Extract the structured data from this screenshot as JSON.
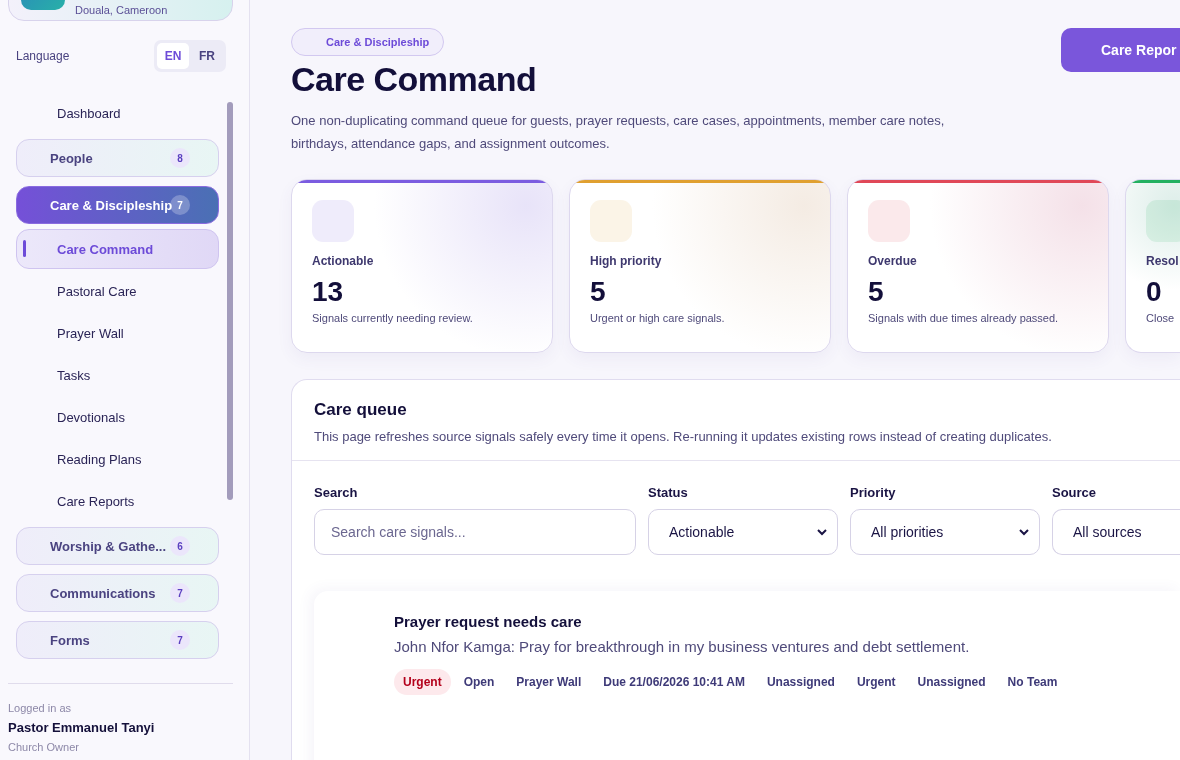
{
  "org": {
    "location": "Douala, Cameroon"
  },
  "language": {
    "label": "Language",
    "options": [
      {
        "label": "EN",
        "selected": true
      },
      {
        "label": "FR",
        "selected": false
      }
    ]
  },
  "nav": [
    {
      "kind": "link",
      "label": "Dashboard",
      "selected": false
    },
    {
      "kind": "group",
      "label": "People",
      "badge": "8",
      "expanded": false
    },
    {
      "kind": "group",
      "label": "Care & Discipleship",
      "badge": "7",
      "expanded": true,
      "children": [
        {
          "label": "Care Command",
          "selected": true
        },
        {
          "label": "Pastoral Care",
          "selected": false
        },
        {
          "label": "Prayer Wall",
          "selected": false
        },
        {
          "label": "Tasks",
          "selected": false
        },
        {
          "label": "Devotionals",
          "selected": false
        },
        {
          "label": "Reading Plans",
          "selected": false
        },
        {
          "label": "Care Reports",
          "selected": false
        }
      ]
    },
    {
      "kind": "group",
      "label": "Worship & Gathe...",
      "badge": "6",
      "expanded": false
    },
    {
      "kind": "group",
      "label": "Communications",
      "badge": "7",
      "expanded": false
    },
    {
      "kind": "group",
      "label": "Forms",
      "badge": "7",
      "expanded": false
    }
  ],
  "user": {
    "caption": "Logged in as",
    "name": "Pastor Emmanuel Tanyi",
    "role": "Church Owner"
  },
  "header": {
    "eyebrow": "Care & Discipleship",
    "title": "Care Command",
    "description": "One non-duplicating command queue for guests, prayer requests, care cases, appointments, member care notes, birthdays, attendance gaps, and assignment outcomes.",
    "action": "Care Repor"
  },
  "stats": [
    {
      "label": "Actionable",
      "value": "13",
      "note": "Signals currently needing review.",
      "color": "#7b5ce0"
    },
    {
      "label": "High priority",
      "value": "5",
      "note": "Urgent or high care signals.",
      "color": "#e0a030"
    },
    {
      "label": "Overdue",
      "value": "5",
      "note": "Signals with due times already passed.",
      "color": "#e04858"
    },
    {
      "label": "Resol",
      "value": "0",
      "note": "Close",
      "color": "#22b060"
    }
  ],
  "queue": {
    "title": "Care queue",
    "description": "This page refreshes source signals safely every time it opens. Re-running it updates existing rows instead of creating duplicates.",
    "filters": [
      {
        "kind": "search",
        "label": "Search",
        "placeholder": "Search care signals..."
      },
      {
        "kind": "select",
        "label": "Status",
        "value": "Actionable"
      },
      {
        "kind": "select",
        "label": "Priority",
        "value": "All priorities"
      },
      {
        "kind": "select",
        "label": "Source",
        "value": "All sources"
      }
    ],
    "items": [
      {
        "title": "Prayer request needs care",
        "summary": "John Nfor Kamga: Pray for breakthrough in my business ventures and debt settlement.",
        "tags": [
          {
            "label": "Urgent",
            "kind": "urgent"
          },
          {
            "label": "Open",
            "kind": "plain"
          },
          {
            "label": "Prayer Wall",
            "kind": "plain"
          },
          {
            "label": "Due 21/06/2026 10:41 AM",
            "kind": "plain"
          },
          {
            "label": "Unassigned",
            "kind": "plain"
          },
          {
            "label": "Urgent",
            "kind": "plain"
          },
          {
            "label": "Unassigned",
            "kind": "plain"
          },
          {
            "label": "No Team",
            "kind": "plain"
          }
        ]
      }
    ]
  }
}
